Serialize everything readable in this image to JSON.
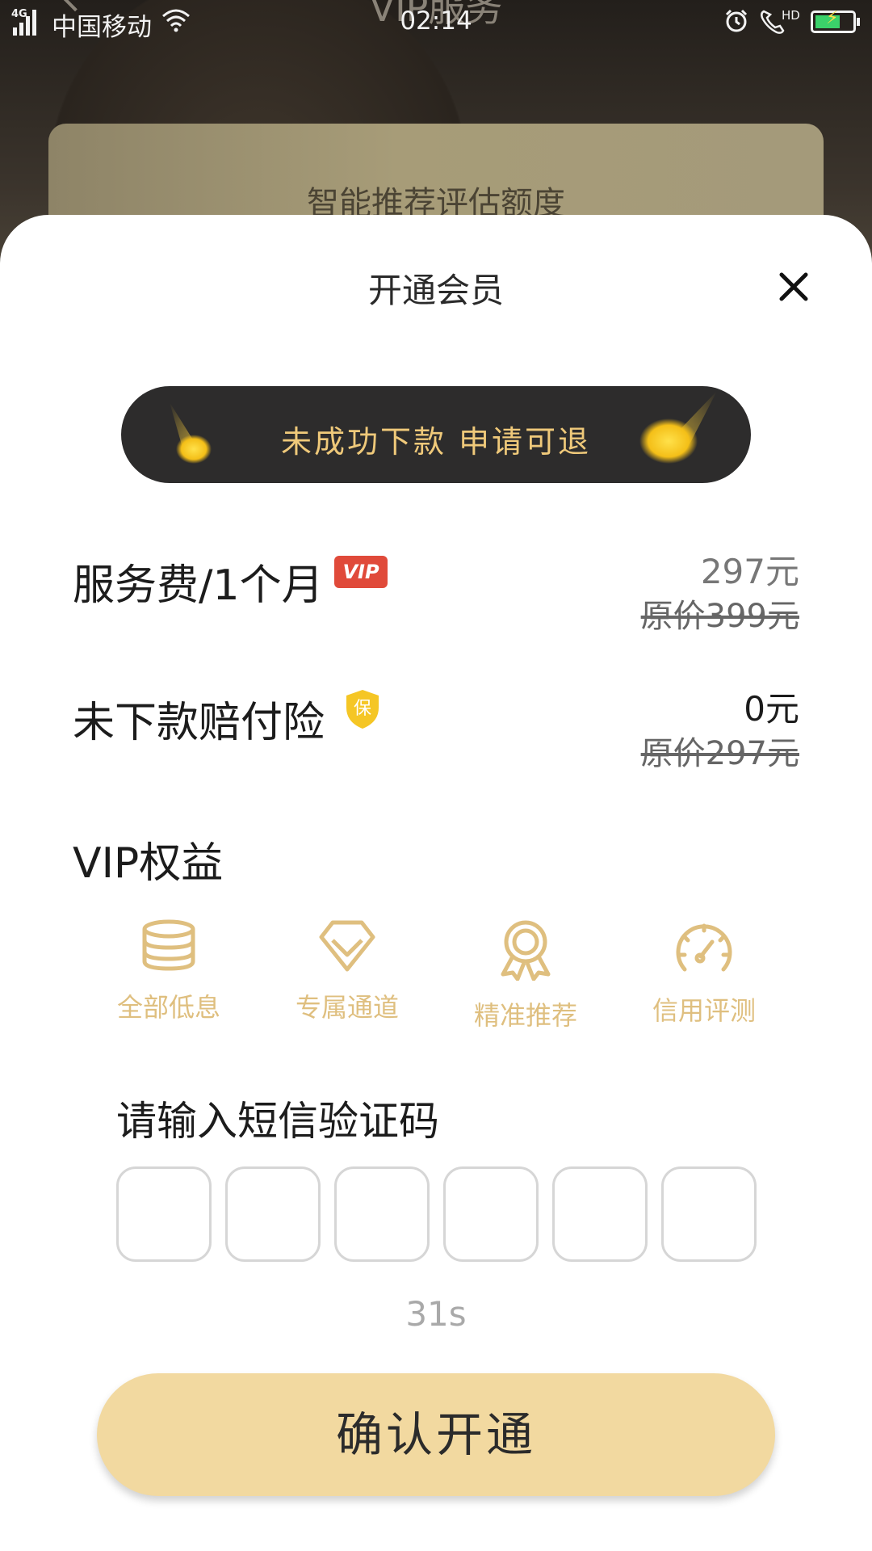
{
  "status_bar": {
    "network": "4G",
    "carrier": "中国移动",
    "time": "02:14",
    "call_badge": "HD"
  },
  "background": {
    "page_title": "VIP服务",
    "card_text": "智能推荐评估额度"
  },
  "sheet": {
    "title": "开通会员",
    "close_icon": "close-icon",
    "banner_text": "未成功下款 申请可退",
    "rows": [
      {
        "label": "服务费/1个月",
        "badge": "VIP",
        "price": "297元",
        "original": "原价399元"
      },
      {
        "label": "未下款赔付险",
        "badge": "保",
        "price": "0元",
        "original": "原价297元"
      }
    ],
    "benefits_title": "VIP权益",
    "benefits": [
      {
        "icon": "database-icon",
        "label": "全部低息"
      },
      {
        "icon": "diamond-icon",
        "label": "专属通道"
      },
      {
        "icon": "medal-icon",
        "label": "精准推荐"
      },
      {
        "icon": "speedometer-icon",
        "label": "信用评测"
      }
    ],
    "sms_title": "请输入短信验证码",
    "code_digits": [
      "",
      "",
      "",
      "",
      "",
      ""
    ],
    "countdown": "31s",
    "confirm_label": "确认开通"
  },
  "colors": {
    "gold_text": "#efc97a",
    "benefit_gold": "#dfbf7f",
    "button_bg": "#f2d9a0",
    "vip_red": "#e04a3a"
  }
}
